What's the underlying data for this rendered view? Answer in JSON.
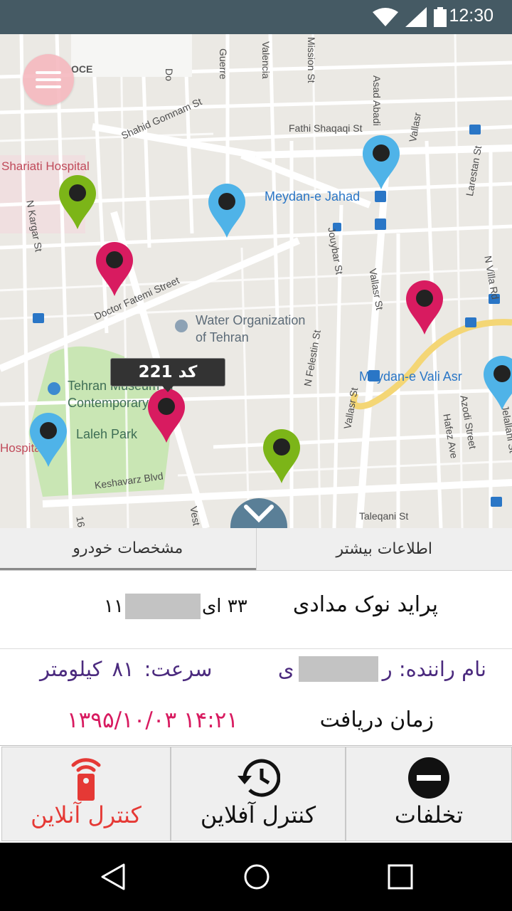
{
  "status_bar": {
    "time": "12:30",
    "icons": [
      "wifi-icon",
      "signal-icon",
      "battery-icon"
    ]
  },
  "map": {
    "streets": [
      {
        "name": "Shahid Gomnam St"
      },
      {
        "name": "Fathi Shaqaqi St"
      },
      {
        "name": "Doctor Fatemi Street"
      },
      {
        "name": "Keshavarz Blvd"
      },
      {
        "name": "Taleqani St"
      },
      {
        "name": "N Kargar St"
      },
      {
        "name": "Jouybar St"
      },
      {
        "name": "Vallasr St"
      },
      {
        "name": "N Felestin St"
      },
      {
        "name": "Azodi Street"
      },
      {
        "name": "Hafez Ave"
      },
      {
        "name": "Larestan St"
      },
      {
        "name": "N Villa Rd"
      },
      {
        "name": "Guerre"
      },
      {
        "name": "Valencia"
      },
      {
        "name": "Mission St"
      },
      {
        "name": "Asad Abadi"
      },
      {
        "name": "Vallasr"
      },
      {
        "name": "Vallasr St"
      },
      {
        "name": "Jelallahi St"
      },
      {
        "name": "OCE"
      },
      {
        "name": "Do"
      },
      {
        "name": "Vest"
      },
      {
        "name": "16"
      }
    ],
    "places": {
      "hospital_top": "Shariati Hospital",
      "hospital_bottom": "Hospital",
      "metro_jahad": "Meydan-e Jahad",
      "metro_valiasr": "Meydan-e Vali Asr",
      "water_org_line1": "Water Organization",
      "water_org_line2": "of Tehran",
      "museum_line1": "Tehran Museum of",
      "museum_line2": "Contemporary",
      "park": "Laleh Park"
    },
    "markers": [
      {
        "color": "green",
        "hex": "#7cb518"
      },
      {
        "color": "blue",
        "hex": "#4fb3e8"
      },
      {
        "color": "blue",
        "hex": "#4fb3e8"
      },
      {
        "color": "pink",
        "hex": "#d81b60"
      },
      {
        "color": "pink",
        "hex": "#d81b60"
      },
      {
        "color": "pink",
        "hex": "#d81b60"
      },
      {
        "color": "blue",
        "hex": "#4fb3e8"
      },
      {
        "color": "green",
        "hex": "#7cb518"
      },
      {
        "color": "blue",
        "hex": "#4fb3e8"
      }
    ],
    "selected_tooltip": "کد 221"
  },
  "tabs": {
    "more_info": "اطلاعات بیشتر",
    "vehicle_specs": "مشخصات خودرو"
  },
  "vehicle": {
    "name": "پراید نوک مدادی",
    "plate_right": "۳۳ ای",
    "plate_left": "۱۱",
    "driver_label": "نام راننده: ر",
    "driver_suffix": "ی",
    "speed_label": "سرعت:",
    "speed_value": "۸۱",
    "speed_unit": "کیلومتر",
    "receive_label": "زمان دریافت",
    "receive_time": "۱۳۹۵/۱۰/۰۳ ۱۴:۲۱"
  },
  "actions": {
    "online": "کنترل آنلاین",
    "offline": "کنترل آفلاین",
    "violations": "تخلفات"
  },
  "colors": {
    "status_bar": "#455a64",
    "accent_red": "#e53935",
    "driver_purple": "#4b2a7e",
    "time_pink": "#d81b60"
  }
}
